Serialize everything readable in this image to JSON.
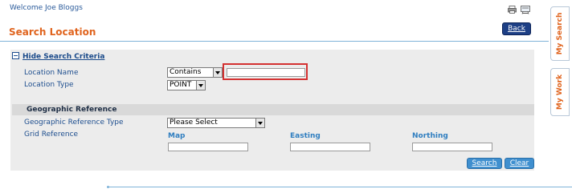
{
  "header": {
    "welcome": "Welcome Joe Bloggs",
    "title": "Search Location",
    "back_label": "Back"
  },
  "criteria": {
    "hide_label": "Hide Search Criteria",
    "location_name_label": "Location Name",
    "location_name_operator": "Contains",
    "location_name_value": "",
    "location_type_label": "Location Type",
    "location_type_value": "POINT"
  },
  "geo": {
    "section_title": "Geographic Reference",
    "type_label": "Geographic Reference Type",
    "type_value": "Please Select",
    "grid_label": "Grid Reference",
    "map_label": "Map",
    "easting_label": "Easting",
    "northing_label": "Northing"
  },
  "actions": {
    "search_label": "Search",
    "clear_label": "Clear"
  },
  "side_tabs": [
    "My Search",
    "My Work"
  ],
  "colors": {
    "accent": "#e0641e",
    "link": "#1f4f8f",
    "button": "#3f8fcf",
    "back_button": "#1d3f85",
    "highlight": "#d43131"
  }
}
